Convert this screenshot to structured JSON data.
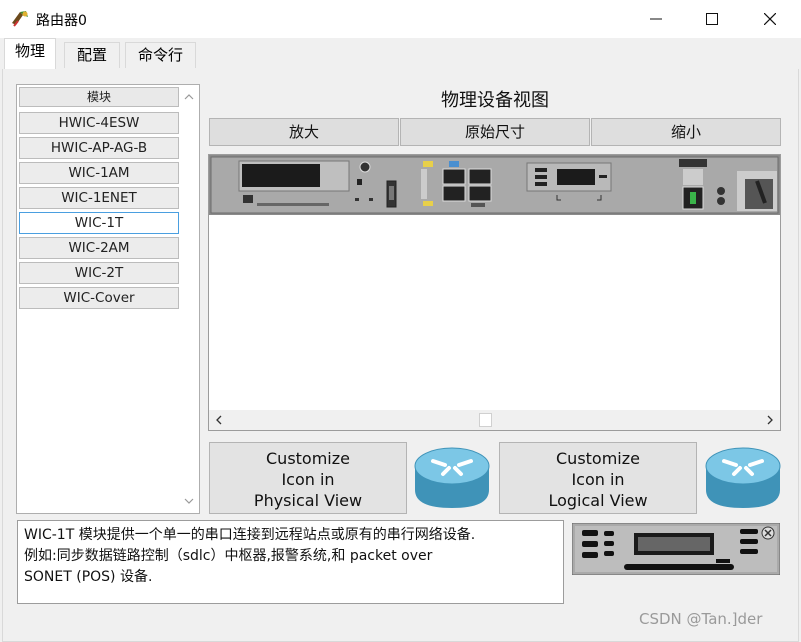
{
  "window": {
    "title": "路由器0",
    "icon": "router-app-icon"
  },
  "tabs": [
    {
      "label": "物理",
      "active": true
    },
    {
      "label": "配置",
      "active": false
    },
    {
      "label": "命令行",
      "active": false
    }
  ],
  "module_list": {
    "header": "模块",
    "items": [
      "HWIC-4ESW",
      "HWIC-AP-AG-B",
      "WIC-1AM",
      "WIC-1ENET",
      "WIC-1T",
      "WIC-2AM",
      "WIC-2T",
      "WIC-Cover"
    ],
    "selected": "WIC-1T"
  },
  "physical_view": {
    "title": "物理设备视图",
    "zoom_in": "放大",
    "original_size": "原始尺寸",
    "zoom_out": "缩小"
  },
  "customize": {
    "physical": "Customize\nIcon in\nPhysical View",
    "logical": "Customize\nIcon in\nLogical View"
  },
  "description": "WIC-1T 模块提供一个单一的串口连接到远程站点或原有的串行网络设备.\n例如:同步数据链路控制（sdlc）中枢器,报警系统,和 packet over\n SONET (POS) 设备.",
  "watermark": "CSDN @Tan.]der",
  "colors": {
    "selection_border": "#4a9fe0",
    "router_blue": "#4aa3c8"
  }
}
